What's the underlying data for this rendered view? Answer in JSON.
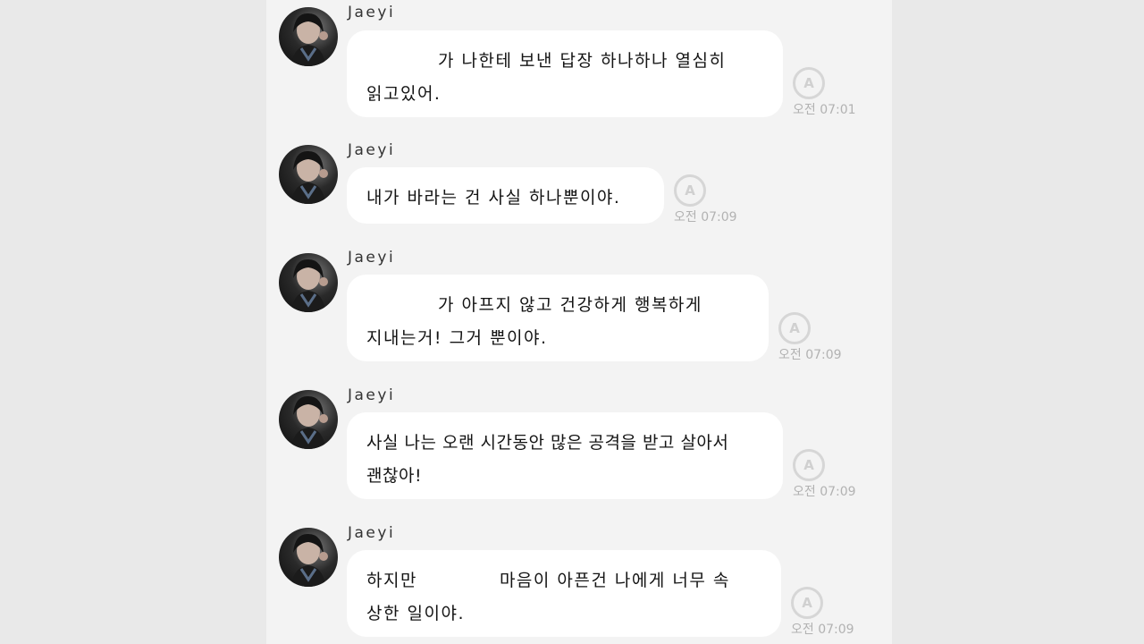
{
  "sender": "Jaeyi",
  "messages": [
    {
      "lines": [
        "가 나한테 보낸 답장 하나하나 열심히",
        "읽고있어."
      ],
      "time": "오전 07:01",
      "read_badge": "A"
    },
    {
      "lines": [
        "내가 바라는 건 사실 하나뿐이야."
      ],
      "time": "오전 07:09",
      "read_badge": "A"
    },
    {
      "lines": [
        "가 아프지 않고 건강하게 행복하게",
        "지내는거! 그거 뿐이야."
      ],
      "time": "오전 07:09",
      "read_badge": "A"
    },
    {
      "lines": [
        "사실 나는 오랜 시간동안 많은 공격을 받고 살아서",
        "괜찮아!"
      ],
      "time": "오전 07:09",
      "read_badge": "A"
    },
    {
      "lines": [
        "하지만",
        "마음이 아픈건 나에게 너무 속",
        "상한 일이야."
      ],
      "time": "오전 07:09",
      "read_badge": "A"
    }
  ]
}
